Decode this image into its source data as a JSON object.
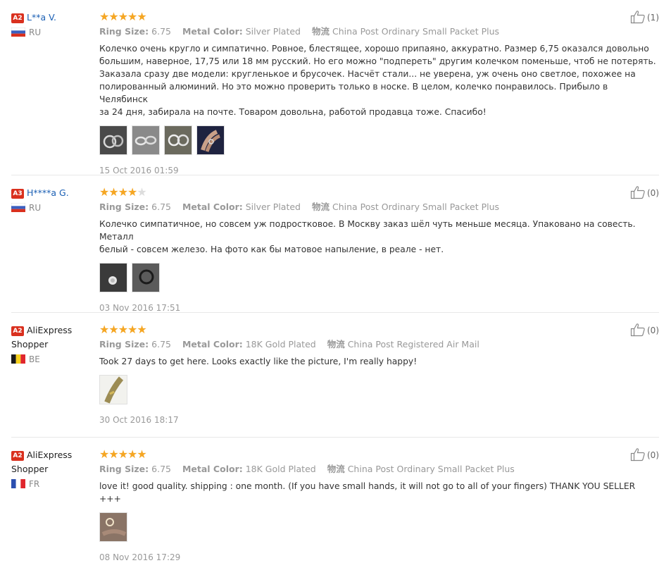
{
  "reviews": [
    {
      "badge": "A2",
      "user": "L**a V.",
      "country": "RU",
      "stars": 5,
      "size_label": "Ring Size:",
      "size": "6.75",
      "color_label": "Metal Color:",
      "color": "Silver Plated",
      "ship_label": "物流",
      "shipping": "China Post Ordinary Small Packet Plus",
      "text": "Колечко очень кругло и симпатично. Ровное, блестящее, хорошо припаяно, аккуратно. Размер 6,75 оказался довольно\nбольшим, наверное, 17,75 или 18 мм русский. Но его можно \"подпереть\" другим колечком поменьше, чтоб не потерять.\nЗаказала сразу две модели: кругленькое и брусочек. Насчёт стали... не уверена, уж очень оно светлое, похожее на\nполированный алюминий. Но это можно проверить только в носке. В целом, колечко понравилось. Прибыло в Челябинск\nза 24 дня, забирала на почте. Товаром довольна, работой продавца тоже. Спасибо!",
      "photos": 4,
      "date": "15 Oct 2016 01:59",
      "helpful": "(1)"
    },
    {
      "badge": "A3",
      "user": "H****a G.",
      "country": "RU",
      "stars": 4,
      "size_label": "Ring Size:",
      "size": "6.75",
      "color_label": "Metal Color:",
      "color": "Silver Plated",
      "ship_label": "物流",
      "shipping": "China Post Ordinary Small Packet Plus",
      "text": "Колечко симпатичное, но совсем уж подростковое. В Москву заказ шёл чуть меньше месяца. Упаковано на совесть. Металл\nбелый - совсем железо. На фото как бы матовое напыление, в реале - нет.",
      "photos": 2,
      "date": "03 Nov 2016 17:51",
      "helpful": "(0)"
    },
    {
      "badge": "A2",
      "user": "AliExpress Shopper",
      "country": "BE",
      "stars": 5,
      "size_label": "Ring Size:",
      "size": "6.75",
      "color_label": "Metal Color:",
      "color": "18K Gold Plated",
      "ship_label": "物流",
      "shipping": "China Post Registered Air Mail",
      "text": "Took 27 days to get here. Looks exactly like the picture, I'm really happy!",
      "photos": 1,
      "date": "30 Oct 2016 18:17",
      "helpful": "(0)"
    },
    {
      "badge": "A2",
      "user": "AliExpress Shopper",
      "country": "FR",
      "stars": 5,
      "size_label": "Ring Size:",
      "size": "6.75",
      "color_label": "Metal Color:",
      "color": "18K Gold Plated",
      "ship_label": "物流",
      "shipping": "China Post Ordinary Small Packet Plus",
      "text": "love it! good quality. shipping : one month. (If you have small hands, it will not go to all of your fingers) THANK YOU SELLER +++",
      "photos": 1,
      "date": "08 Nov 2016 17:29",
      "helpful": "(0)"
    }
  ],
  "colors": {
    "star": "#f5a623",
    "star_empty": "#dddddd",
    "badge": "#d9301e",
    "link": "#1a5fb4",
    "muted": "#999999"
  },
  "icons": {
    "rating": "star-icon",
    "helpful": "thumbs-up-icon",
    "flag": "country-flag-icon"
  }
}
